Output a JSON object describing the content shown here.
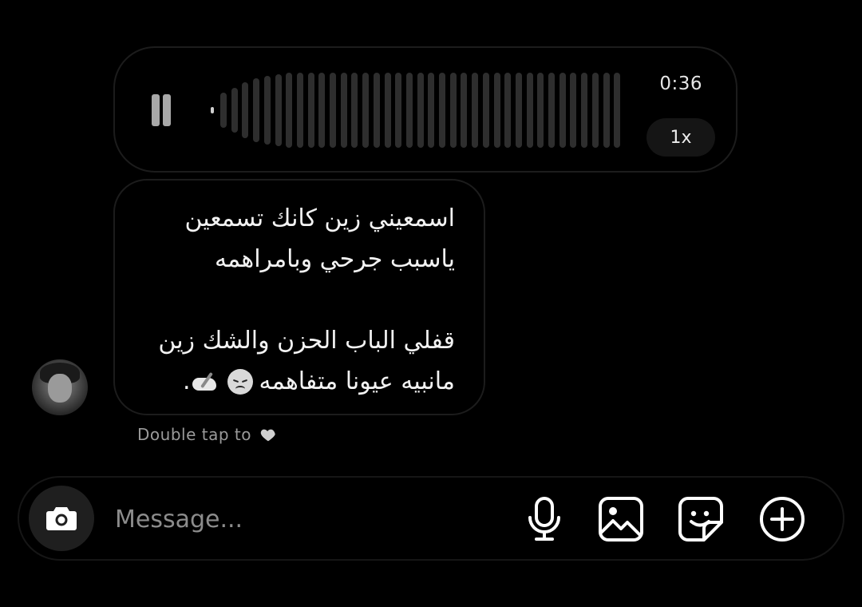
{
  "voice_message": {
    "duration": "0:36",
    "speed": "1x"
  },
  "text_message": {
    "lines": [
      "اسمعيني زين كانك تسمعين",
      "ياسبب جرحي وبامراهمه",
      "",
      "قفلي الباب الحزن والشك زين",
      "مانبيه عيونا متفاهمه"
    ],
    "trailing": ".",
    "emojis": [
      "disappointed-face-emoji",
      "writing-hand-emoji"
    ]
  },
  "reaction_hint": {
    "text": "Double tap to"
  },
  "composer": {
    "placeholder": "Message..."
  },
  "colors": {
    "background": "#000000",
    "bubble_border": "#1c1c1c",
    "waveform_unplayed": "#2e2e2e",
    "hint_text": "#9a9a9a"
  }
}
